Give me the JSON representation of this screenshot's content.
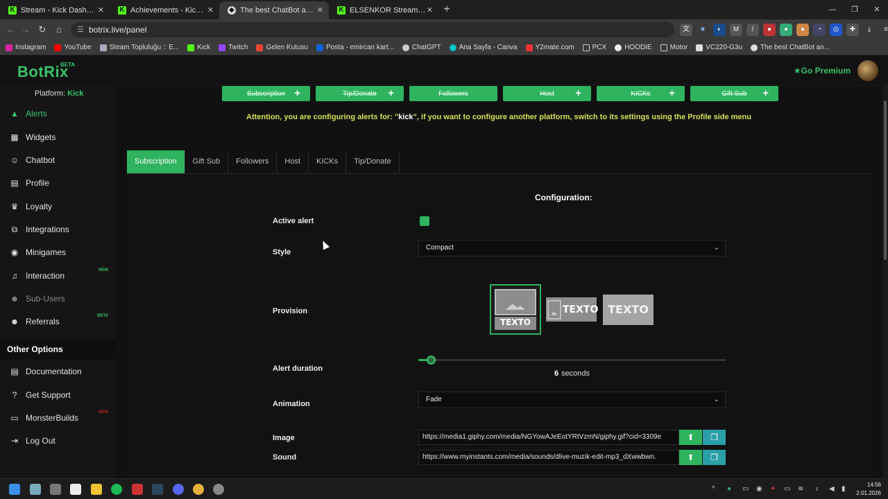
{
  "browser": {
    "tabs": [
      {
        "title": "Stream - Kick Dashboard",
        "favicon": "K"
      },
      {
        "title": "Achievements - Kick Dashboard",
        "favicon": "K"
      },
      {
        "title": "The best ChatBot and Widgets",
        "favicon": "◆"
      },
      {
        "title": "ELSENKOR Stream - Watch Live",
        "favicon": "K"
      }
    ],
    "url": "botrix.live/panel",
    "bookmarks": [
      "Instagram",
      "YouTube",
      "Steam Topluluğu :: E...",
      "Kick",
      "Twitch",
      "Gelen Kutusu",
      "Posta - emircan kart...",
      "ChatGPT",
      "Ana Sayfa - Canva",
      "Y2mate.com",
      "PCX",
      "HOODIE",
      "Motor",
      "VC220-G3u",
      "The best ChatBot an..."
    ]
  },
  "header": {
    "logo": "BotRix",
    "logo_badge": "BETA",
    "premium": "Go Premium"
  },
  "sidebar": {
    "platform_label": "Platform:",
    "platform_value": "Kick",
    "items": [
      {
        "label": "Alerts",
        "icon": "warning-icon",
        "glyph": "▲"
      },
      {
        "label": "Widgets",
        "icon": "widgets-icon",
        "glyph": "▦"
      },
      {
        "label": "Chatbot",
        "icon": "robot-icon",
        "glyph": "☺"
      },
      {
        "label": "Profile",
        "icon": "profile-icon",
        "glyph": "▤"
      },
      {
        "label": "Loyalty",
        "icon": "trophy-icon",
        "glyph": "♛"
      },
      {
        "label": "Integrations",
        "icon": "integrations-icon",
        "glyph": "⧉"
      },
      {
        "label": "Minigames",
        "icon": "gamepad-icon",
        "glyph": "◉"
      },
      {
        "label": "Interaction",
        "icon": "music-icon",
        "glyph": "♫",
        "tag": "NEW"
      },
      {
        "label": "Sub-Users",
        "icon": "sub-users-icon",
        "glyph": "☻"
      },
      {
        "label": "Referrals",
        "icon": "users-icon",
        "glyph": "☻",
        "tag": "BETA"
      }
    ],
    "other_options": "Other Options",
    "other_items": [
      {
        "label": "Documentation",
        "icon": "book-icon",
        "glyph": "▤"
      },
      {
        "label": "Get Support",
        "icon": "question-icon",
        "glyph": "?"
      },
      {
        "label": "MonsterBuilds",
        "icon": "monitor-icon",
        "glyph": "▭",
        "tag": "NEW"
      },
      {
        "label": "Log Out",
        "icon": "logout-icon",
        "glyph": "⇥"
      }
    ]
  },
  "top_buttons": [
    "Subscription",
    "Tip/Donate",
    "Followers",
    "Host",
    "KICKs",
    "Gift Sub"
  ],
  "attention": {
    "prefix": "Attention, you are configuring alerts for: \"",
    "platform": "kick",
    "suffix": "\", if you want to configure another platform, switch to its settings using the Profile side menu"
  },
  "tabs": [
    "Subscription",
    "Gift Sub",
    "Followers",
    "Host",
    "KICKs",
    "Tip/Donate"
  ],
  "config": {
    "title": "Configuration:",
    "active_alert_label": "Active alert",
    "style_label": "Style",
    "style_value": "Compact",
    "provision_label": "Provision",
    "provision_text": "TEXTO",
    "alert_duration_label": "Alert duration",
    "duration_value": "6",
    "duration_unit": "seconds",
    "duration_fraction": 0.04,
    "animation_label": "Animation",
    "animation_value": "Fade",
    "image_label": "Image",
    "image_url": "https://media1.giphy.com/media/NGYowAJeEotYRtVzmN/giphy.gif?cid=3309e",
    "sound_label": "Sound",
    "sound_url": "https://www.myinstants.com/media/sounds/dlive-muzik-edit-mp3_dXwwbwn."
  },
  "taskbar": {
    "time": "14:56",
    "date": "2.01.2026"
  },
  "colors": {
    "accent": "#2fb35f",
    "warning": "#d4e157"
  }
}
